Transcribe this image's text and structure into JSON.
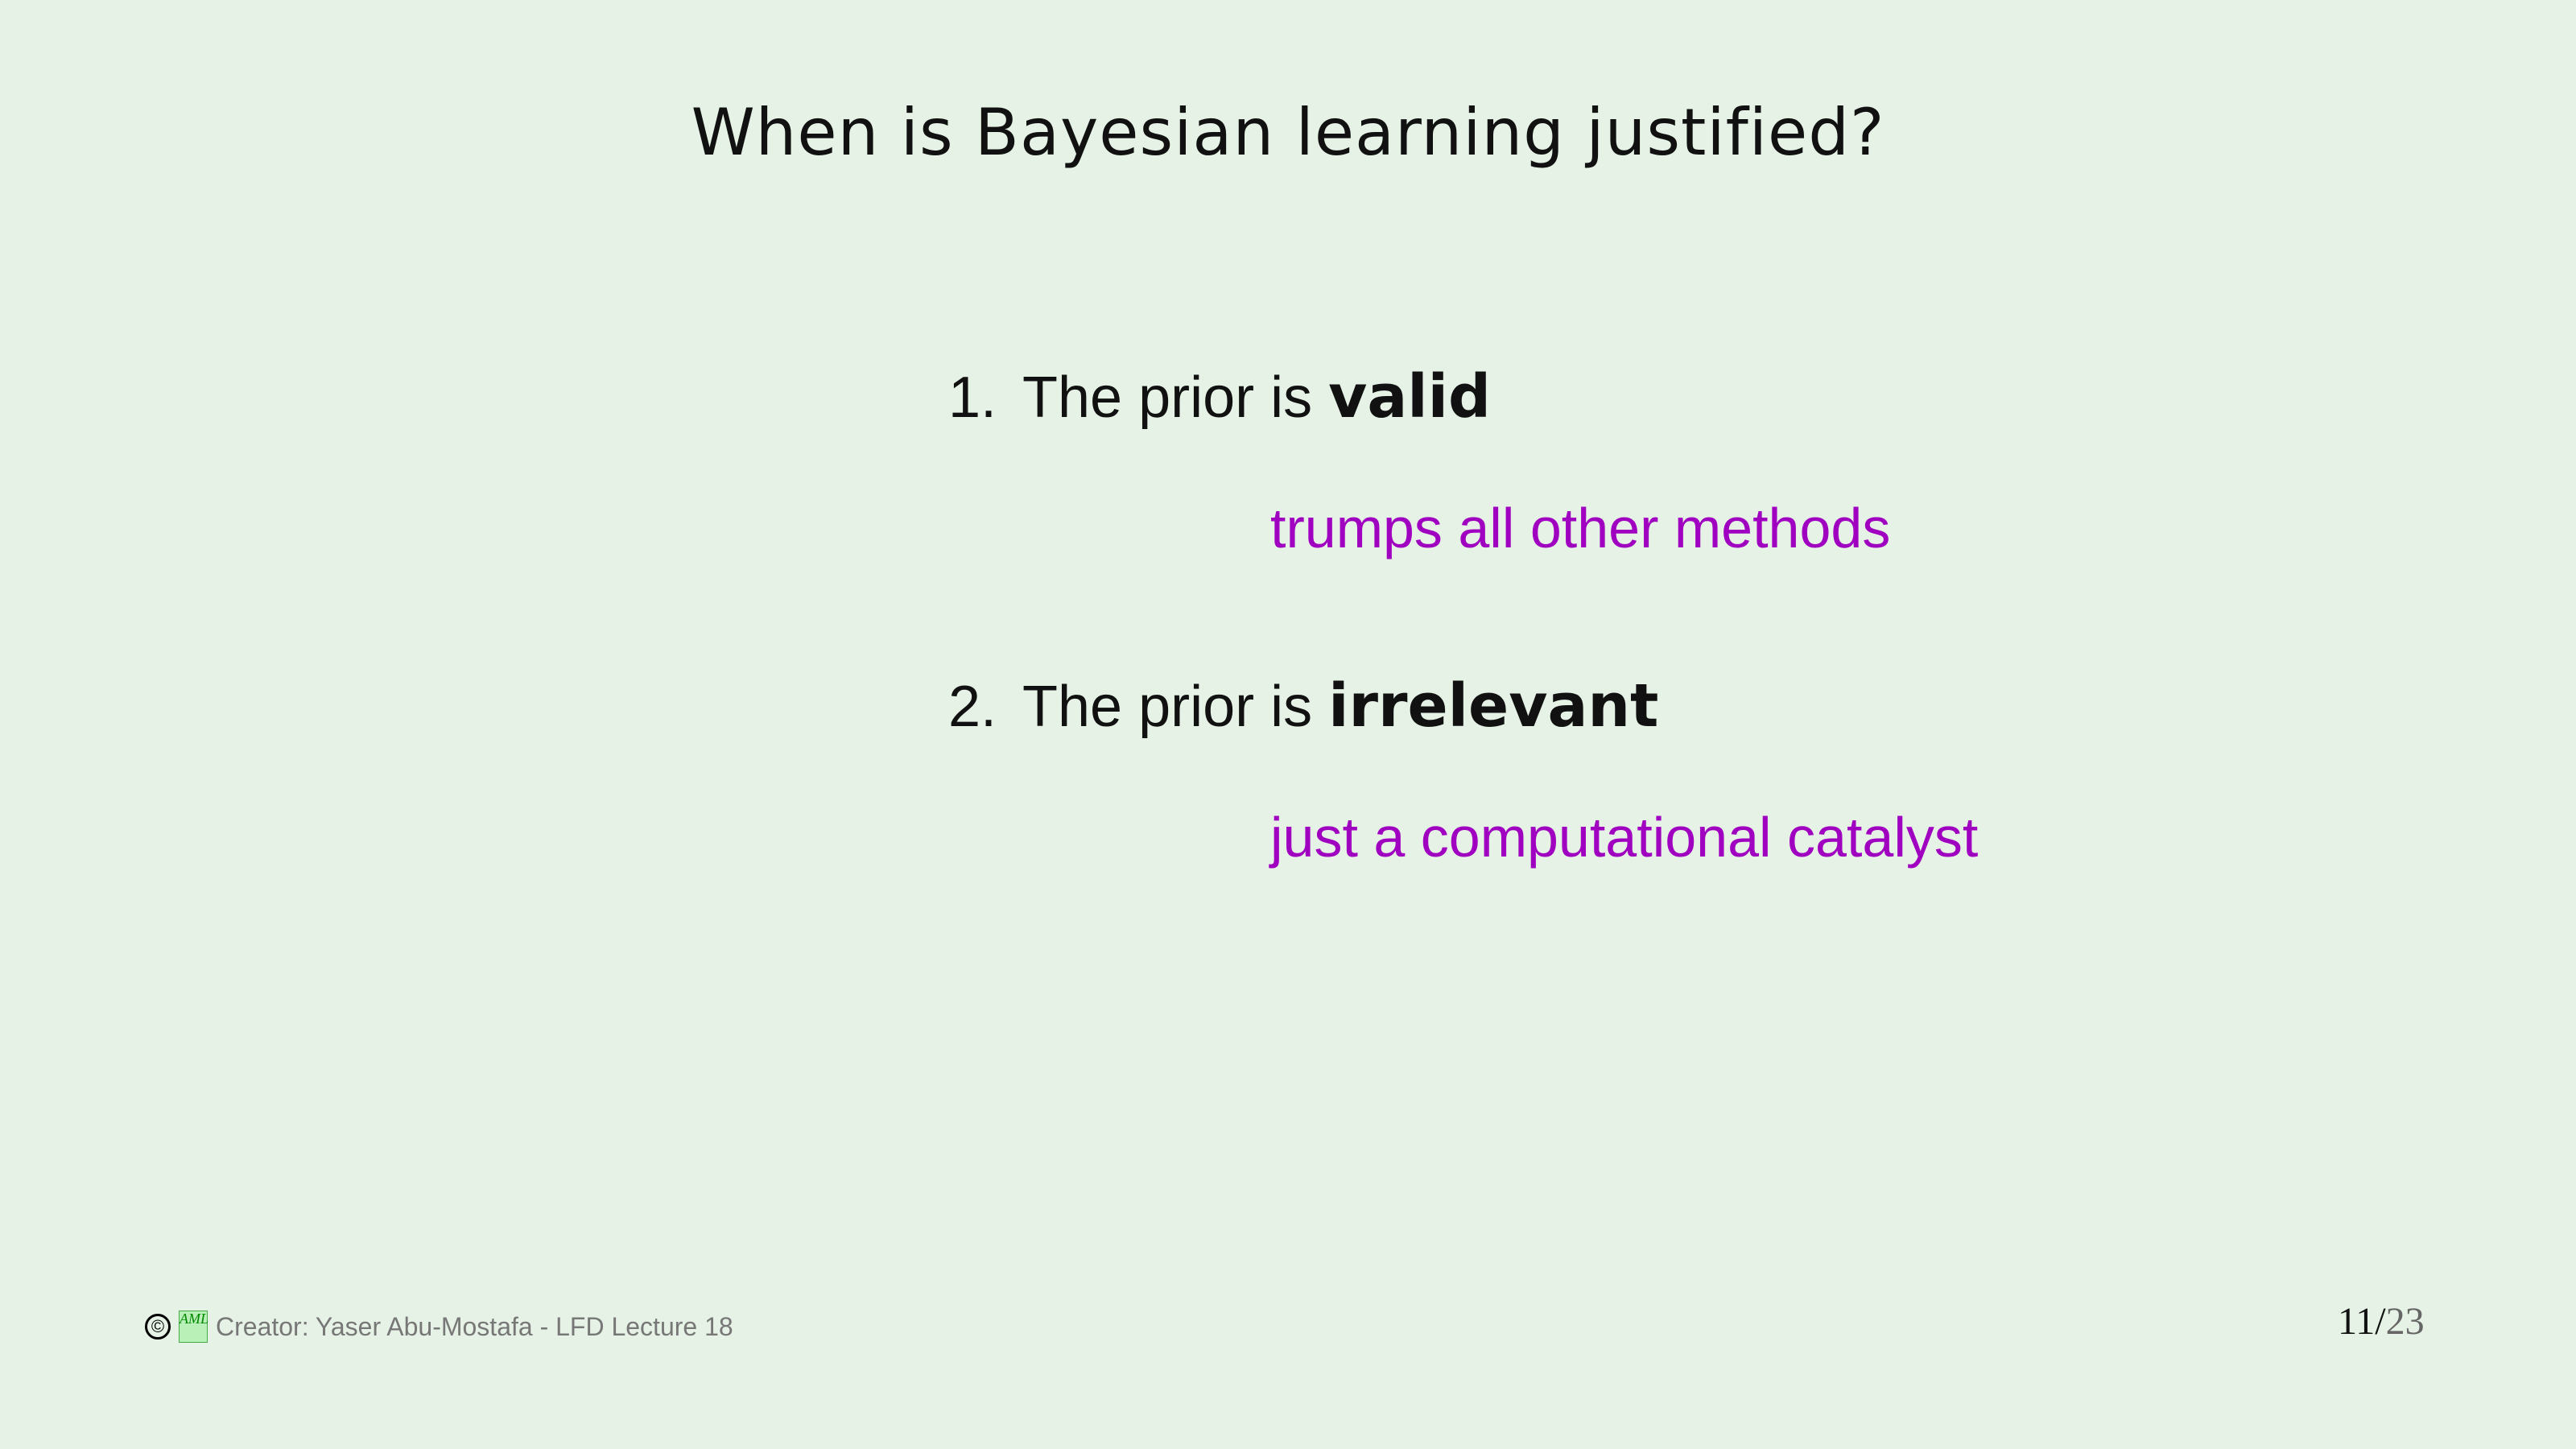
{
  "title": "When is Bayesian learning justified?",
  "items": [
    {
      "number": "1.",
      "text": "The prior is ",
      "emphasis": "valid",
      "note": "trumps all other methods"
    },
    {
      "number": "2.",
      "text": "The prior is ",
      "emphasis": "irrelevant",
      "note": "just a computational catalyst"
    }
  ],
  "footer": {
    "copyright": "©",
    "logo": "AML",
    "credit": "Creator: Yaser Abu-Mostafa - LFD Lecture 18"
  },
  "page": {
    "current": "11",
    "separator": "/",
    "total": "23"
  },
  "colors": {
    "background": "#e5f2e5",
    "note": "#a000c0"
  }
}
